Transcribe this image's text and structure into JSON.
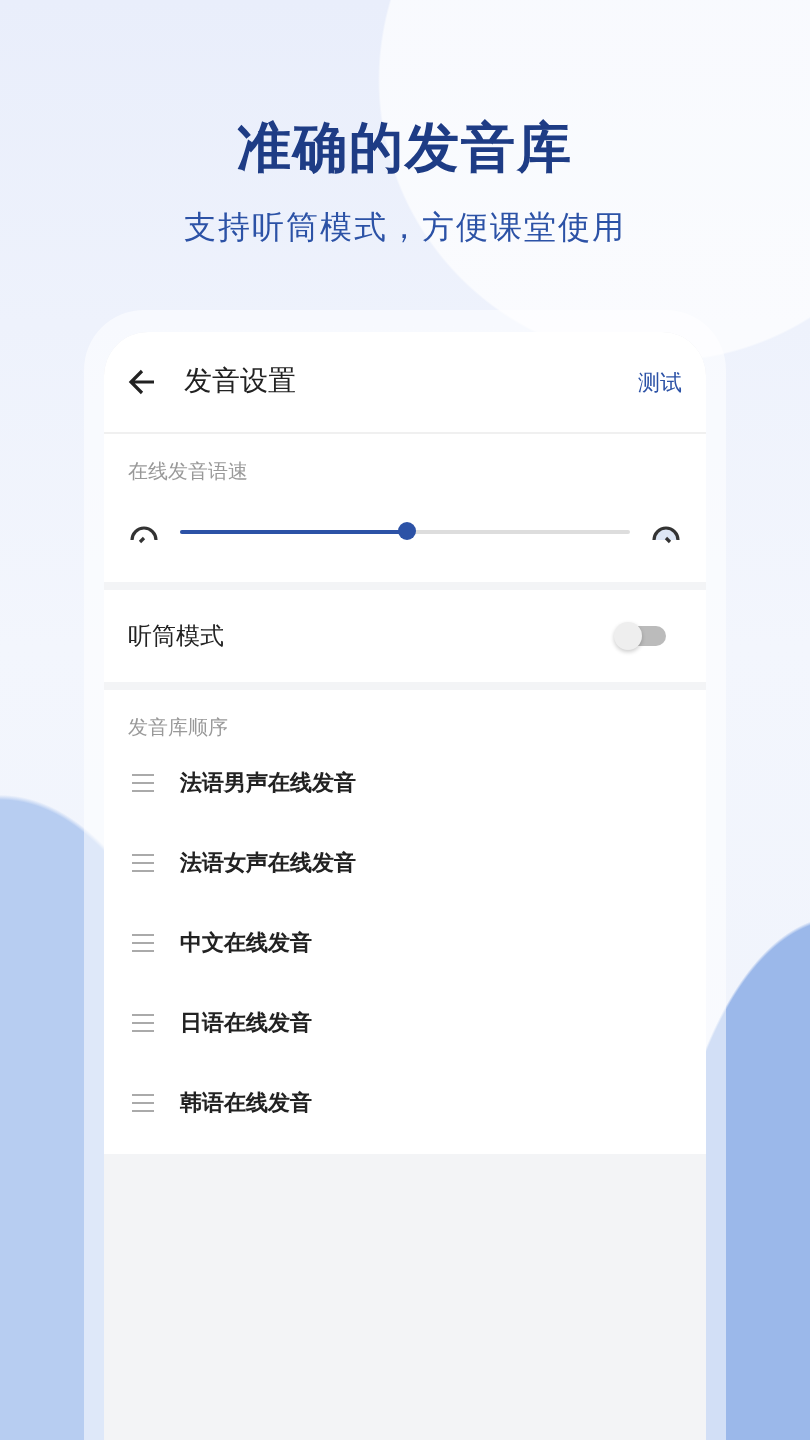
{
  "promo": {
    "headline": "准确的发音库",
    "subtitle": "支持听筒模式，方便课堂使用"
  },
  "header": {
    "title": "发音设置",
    "action": "测试"
  },
  "speed": {
    "label": "在线发音语速",
    "level": 0.5
  },
  "earpiece": {
    "label": "听筒模式",
    "on": false
  },
  "library": {
    "label": "发音库顺序",
    "items": [
      {
        "name": "法语男声在线发音"
      },
      {
        "name": "法语女声在线发音"
      },
      {
        "name": "中文在线发音"
      },
      {
        "name": "日语在线发音"
      },
      {
        "name": "韩语在线发音"
      }
    ]
  }
}
